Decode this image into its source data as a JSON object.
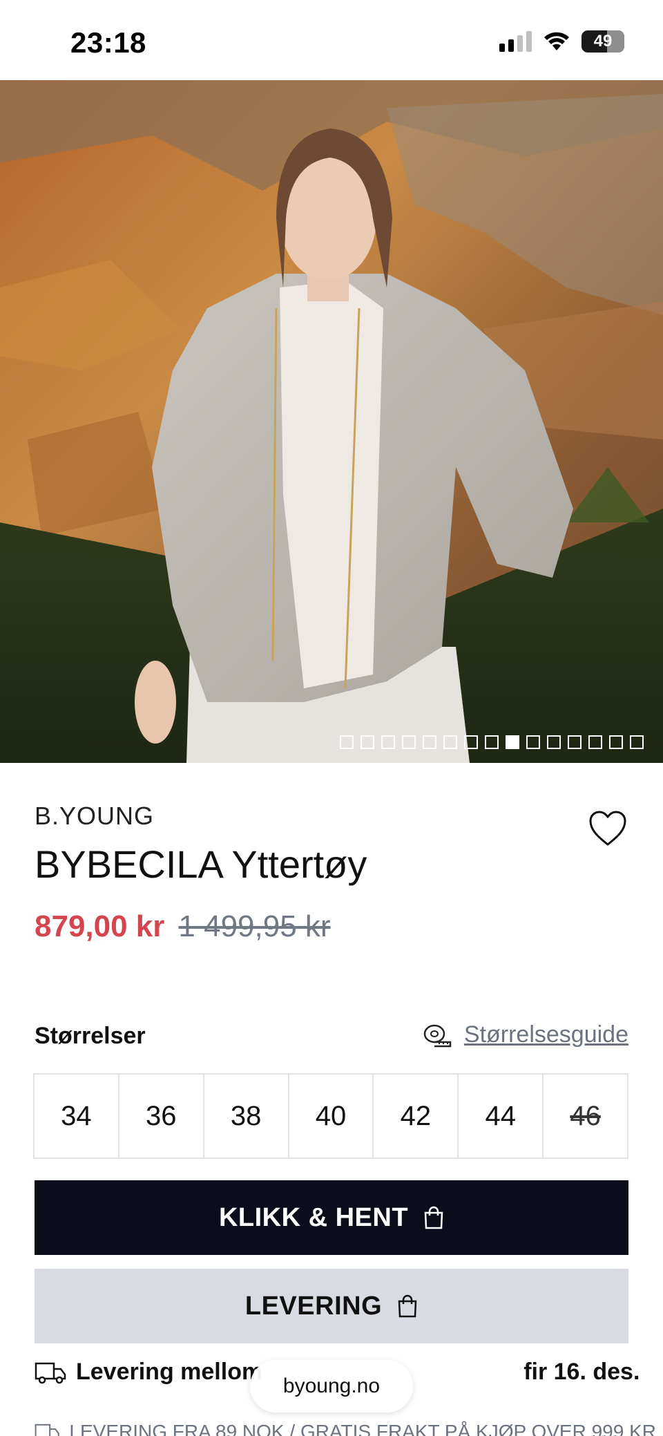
{
  "status_bar": {
    "time": "23:18",
    "battery": "49",
    "icons": [
      "signal-icon",
      "wifi-icon",
      "battery-icon"
    ]
  },
  "gallery": {
    "total_images": 15,
    "active_index": 8
  },
  "product": {
    "brand": "B.YOUNG",
    "name": "BYBECILA Yttertøy",
    "price_sale": "879,00 kr",
    "price_original": "1 499,95 kr",
    "sale_color": "#d5454f"
  },
  "sizes": {
    "label": "Størrelser",
    "guide_label": "Størrelsesguide",
    "options": [
      {
        "label": "34",
        "available": true
      },
      {
        "label": "36",
        "available": true
      },
      {
        "label": "38",
        "available": true
      },
      {
        "label": "40",
        "available": true
      },
      {
        "label": "42",
        "available": true
      },
      {
        "label": "44",
        "available": true
      },
      {
        "label": "46",
        "available": false
      }
    ]
  },
  "actions": {
    "pickup_label": "KLIKK & HENT",
    "delivery_label": "LEVERING"
  },
  "delivery": {
    "info_before": "Levering mellom",
    "info_after": "fir 16. des.",
    "shipping_note": "LEVERING FRA 89 NOK / GRATIS FRAKT PÅ KJØP OVER 999 KR"
  },
  "browser": {
    "url": "byoung.no"
  }
}
